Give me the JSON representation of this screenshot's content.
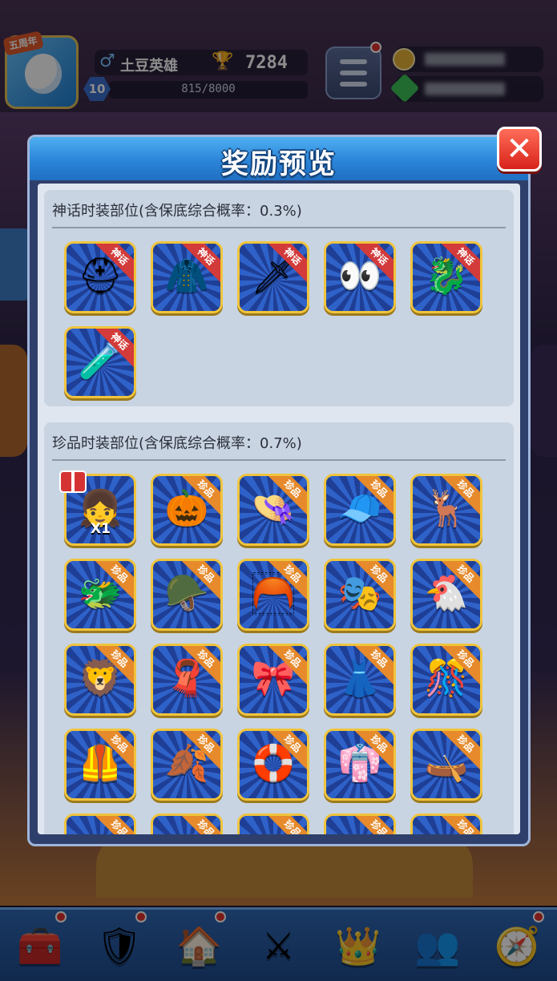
{
  "player": {
    "anniversary_badge": "五周年",
    "name": "土豆英雄",
    "trophies": "7284",
    "level": "10",
    "exp": "815/8000"
  },
  "modal": {
    "title": "奖励预览",
    "close_icon": "close-x-icon",
    "sections": [
      {
        "title": "神话时装部位(含保底综合概率：0.3%)",
        "tag": "神话",
        "items": [
          {
            "icon": "dark-helmet-icon",
            "glyph": "⛑"
          },
          {
            "icon": "dark-cape-icon",
            "glyph": "🧥"
          },
          {
            "icon": "ice-sword-icon",
            "glyph": "🗡"
          },
          {
            "icon": "glowing-eyes-icon",
            "glyph": "👀"
          },
          {
            "icon": "skeleton-dragon-icon",
            "glyph": "🐉"
          },
          {
            "icon": "blue-potion-icon",
            "glyph": "🧪"
          }
        ]
      },
      {
        "title": "珍品时装部位(含保底综合概率：0.7%)",
        "tag": "珍品",
        "items": [
          {
            "icon": "character-portrait-icon",
            "glyph": "👧",
            "qty": "X1"
          },
          {
            "icon": "pumpkin-hat-icon",
            "glyph": "🎃"
          },
          {
            "icon": "witch-hat-icon",
            "glyph": "👒"
          },
          {
            "icon": "knit-beanie-icon",
            "glyph": "🧢"
          },
          {
            "icon": "reindeer-hat-icon",
            "glyph": "🦌"
          },
          {
            "icon": "dragon-head-hat-icon",
            "glyph": "🐲"
          },
          {
            "icon": "green-beret-icon",
            "glyph": "🪖"
          },
          {
            "icon": "orange-hair-icon",
            "glyph": "🦰"
          },
          {
            "icon": "black-mask-icon",
            "glyph": "🎭"
          },
          {
            "icon": "chicken-hat-icon",
            "glyph": "🐔"
          },
          {
            "icon": "lion-dance-hat-icon",
            "glyph": "🦁"
          },
          {
            "icon": "red-cloak-icon",
            "glyph": "🧣"
          },
          {
            "icon": "bow-belt-icon",
            "glyph": "🎀"
          },
          {
            "icon": "brown-skirt-icon",
            "glyph": "👗"
          },
          {
            "icon": "festive-collar-icon",
            "glyph": "🎊"
          },
          {
            "icon": "red-armor-icon",
            "glyph": "🦺"
          },
          {
            "icon": "leaf-skirt-icon",
            "glyph": "🍂"
          },
          {
            "icon": "float-ring-icon",
            "glyph": "🛟"
          },
          {
            "icon": "blue-kilt-icon",
            "glyph": "👘"
          },
          {
            "icon": "boat-skirt-icon",
            "glyph": "🛶"
          },
          {
            "icon": "partial-item-icon",
            "glyph": ""
          },
          {
            "icon": "partial-item-icon",
            "glyph": ""
          },
          {
            "icon": "partial-item-icon",
            "glyph": ""
          },
          {
            "icon": "partial-item-icon",
            "glyph": ""
          },
          {
            "icon": "partial-item-icon",
            "glyph": ""
          }
        ]
      }
    ]
  },
  "bottom_nav": [
    {
      "icon": "treasure-chest-icon",
      "glyph": "🧰",
      "badge": true
    },
    {
      "icon": "knight-helmet-icon",
      "glyph": "🛡",
      "badge": true
    },
    {
      "icon": "house-icon",
      "glyph": "🏠",
      "badge": true
    },
    {
      "icon": "crossed-swords-icon",
      "glyph": "⚔",
      "badge": false
    },
    {
      "icon": "crown-shield-icon",
      "glyph": "👑",
      "badge": false
    },
    {
      "icon": "guild-banner-icon",
      "glyph": "👥",
      "badge": false
    },
    {
      "icon": "compass-icon",
      "glyph": "🧭",
      "badge": true
    }
  ]
}
